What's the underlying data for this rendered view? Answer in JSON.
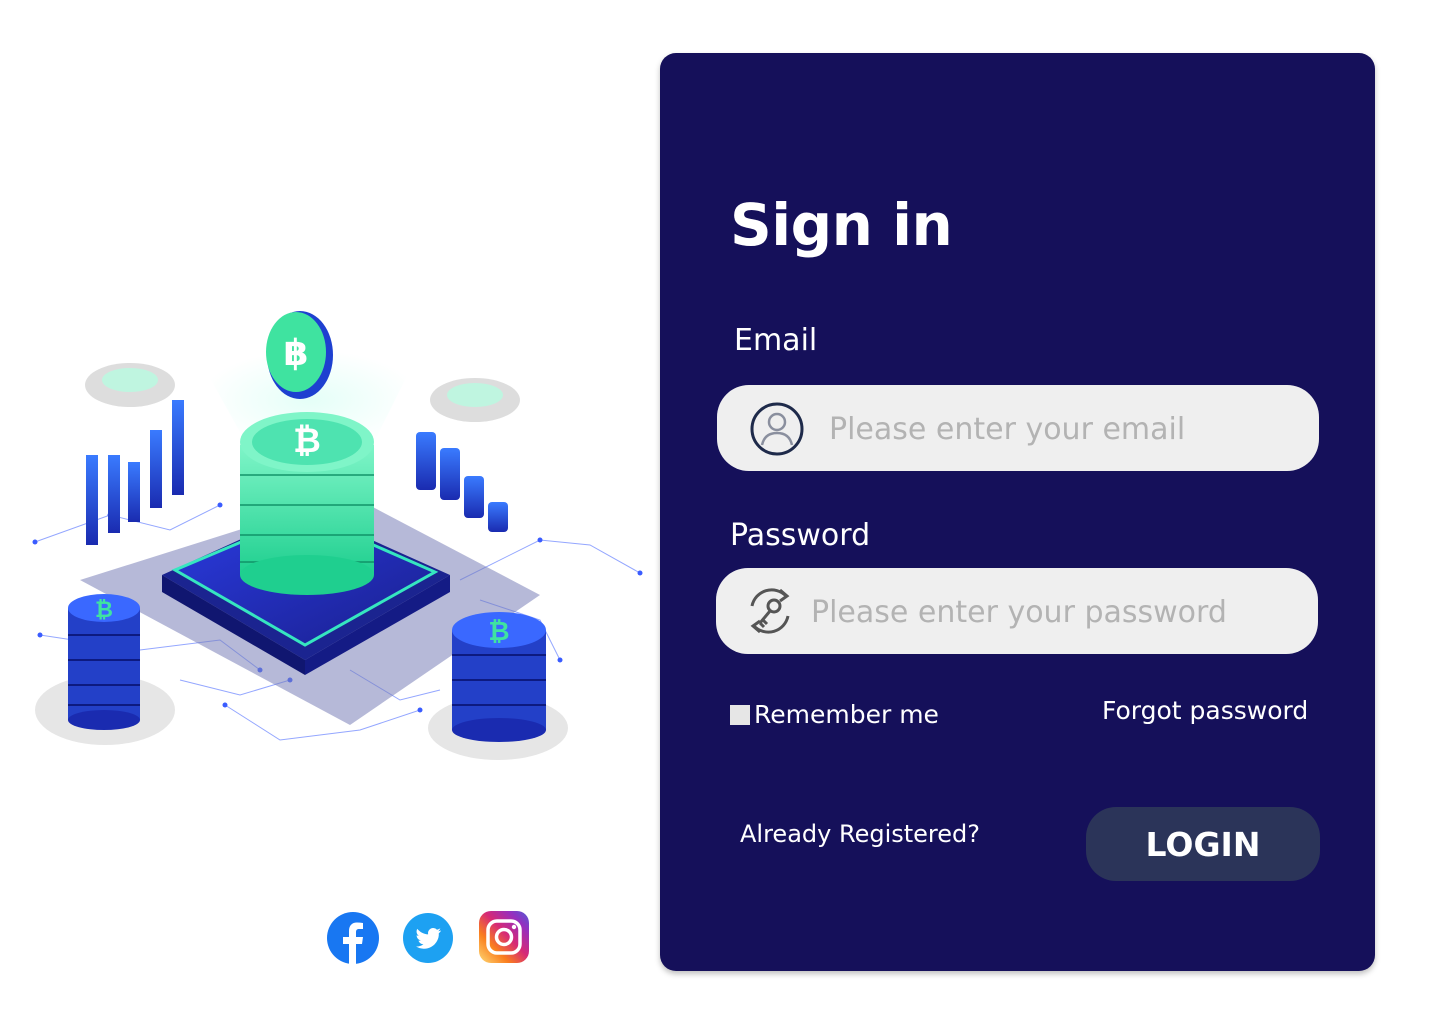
{
  "signin": {
    "title": "Sign in",
    "email_label": "Email",
    "email_placeholder": "Please enter your email",
    "password_label": "Password",
    "password_placeholder": "Please enter your password",
    "remember_label": "Remember me",
    "remember_checked": false,
    "forgot_label": "Forgot password",
    "already_label": "Already Registered?",
    "login_label": "LOGIN"
  },
  "social": [
    {
      "name": "facebook",
      "icon": "facebook-icon"
    },
    {
      "name": "twitter",
      "icon": "twitter-icon"
    },
    {
      "name": "instagram",
      "icon": "instagram-icon"
    }
  ],
  "colors": {
    "panel_bg": "#15105a",
    "field_bg": "#efefef",
    "button_bg": "#2b3459",
    "accent_green": "#3fe3a0",
    "accent_blue": "#2448d8"
  }
}
